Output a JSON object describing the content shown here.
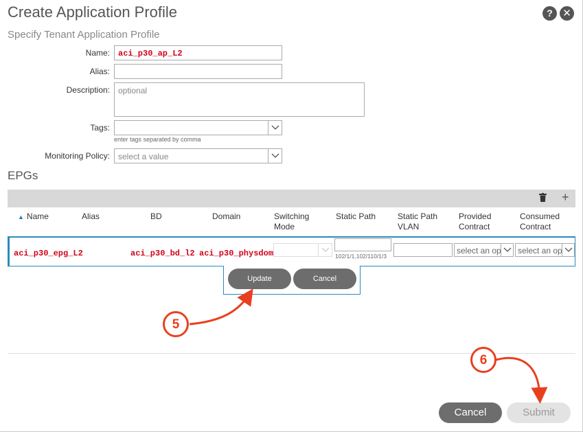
{
  "dialog": {
    "title": "Create Application Profile",
    "subtitle": "Specify Tenant Application Profile",
    "help_glyph": "?",
    "close_glyph": "✕"
  },
  "form": {
    "name_label": "Name:",
    "name_value": "aci_p30_ap_L2",
    "alias_label": "Alias:",
    "alias_value": "",
    "description_label": "Description:",
    "description_placeholder": "optional",
    "tags_label": "Tags:",
    "tags_hint": "enter tags separated by comma",
    "monitoring_label": "Monitoring Policy:",
    "monitoring_placeholder": "select a value"
  },
  "epgs": {
    "section_title": "EPGs",
    "toolbar": {
      "delete_icon": "trash-icon",
      "add_icon": "plus-icon",
      "add_glyph": "+"
    },
    "columns": {
      "name": "Name",
      "alias": "Alias",
      "bd": "BD",
      "domain": "Domain",
      "switching_mode_1": "Switching",
      "switching_mode_2": "Mode",
      "static_path": "Static Path",
      "static_path_vlan_1": "Static Path",
      "static_path_vlan_2": "VLAN",
      "provided_contract_1": "Provided",
      "provided_contract_2": "Contract",
      "consumed_contract_1": "Consumed",
      "consumed_contract_2": "Contract"
    },
    "row": {
      "name": "aci_p30_epg_L2",
      "bd": "aci_p30_bd_l2",
      "domain": "aci_p30_physdom",
      "static_path_hint": "102/1/1,102/110/1/3",
      "provided_placeholder": "select an option",
      "consumed_placeholder": "select an option"
    },
    "update_label": "Update",
    "cancel_label": "Cancel"
  },
  "footer": {
    "cancel_label": "Cancel",
    "submit_label": "Submit"
  },
  "callouts": {
    "step5": "5",
    "step6": "6",
    "color": "#e8401f"
  }
}
